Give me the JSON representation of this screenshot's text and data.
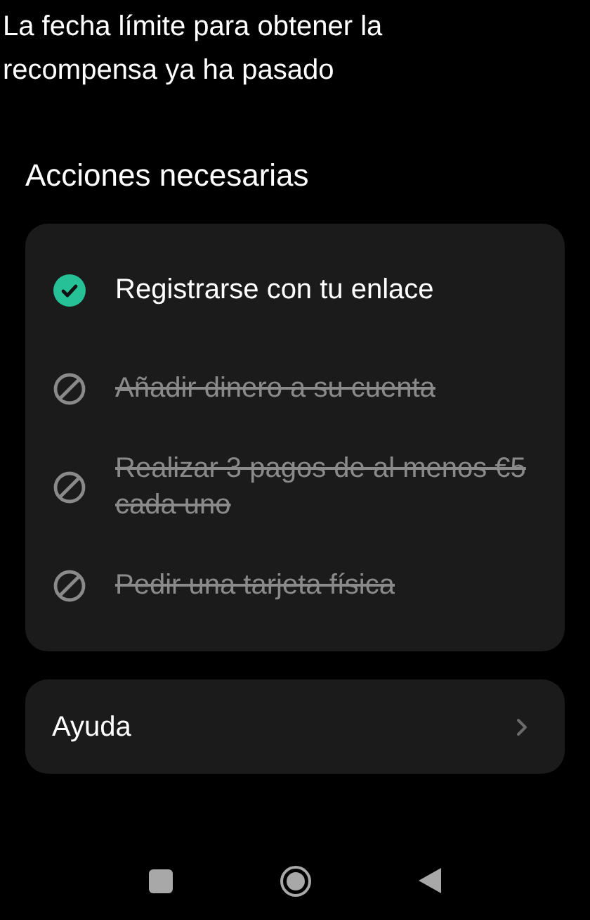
{
  "notice": "La fecha límite para obtener la recompensa ya ha pasado",
  "section_title": "Acciones necesarias",
  "actions": [
    {
      "label": "Registrarse con tu enlace",
      "completed": true
    },
    {
      "label": "Añadir dinero a su cuenta",
      "completed": false
    },
    {
      "label": "Realizar 3 pagos de al menos €5 cada uno",
      "completed": false
    },
    {
      "label": "Pedir una tarjeta física",
      "completed": false
    }
  ],
  "help": {
    "label": "Ayuda"
  }
}
